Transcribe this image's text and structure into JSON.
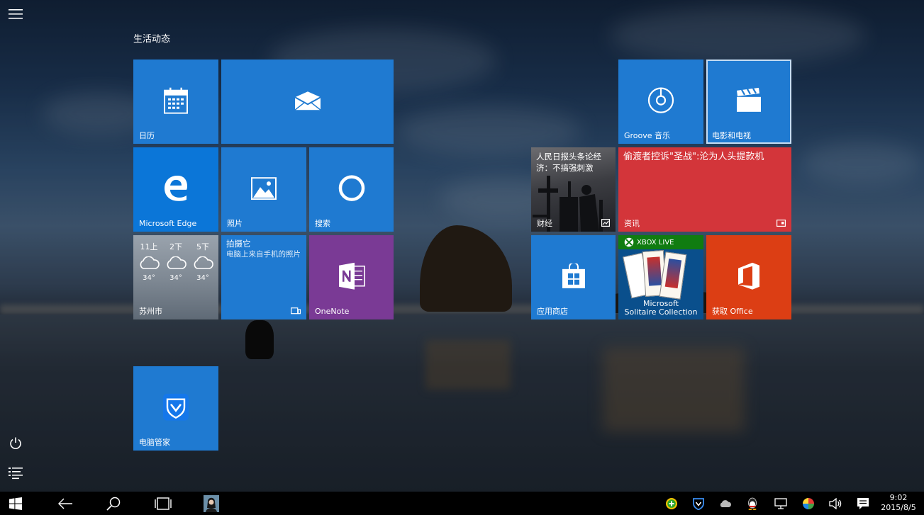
{
  "start": {
    "group_title": "生活动态",
    "tiles": {
      "calendar": {
        "label": "日历"
      },
      "mail": {
        "label": ""
      },
      "edge": {
        "label": "Microsoft Edge"
      },
      "photos": {
        "label": "照片"
      },
      "search": {
        "label": "搜索"
      },
      "weather": {
        "city": "苏州市",
        "forecast": [
          {
            "time": "11上",
            "temp": "34°"
          },
          {
            "time": "2下",
            "temp": "34°"
          },
          {
            "time": "5下",
            "temp": "34°"
          }
        ]
      },
      "camera": {
        "title": "拍摄它",
        "desc": "电脑上来自手机的照片"
      },
      "onenote": {
        "label": "OneNote"
      },
      "groove": {
        "label": "Groove 音乐"
      },
      "movies": {
        "label": "电影和电视"
      },
      "finance": {
        "headline": "人民日报头条论经济：不搞强刺激",
        "label": "财经"
      },
      "news": {
        "headline": "偷渡者控诉\"圣战\":沦为人头提款机",
        "label": "资讯"
      },
      "store": {
        "label": "应用商店"
      },
      "solitaire": {
        "badge": "XBOX LIVE",
        "line1": "Microsoft",
        "line2": "Solitaire Collection"
      },
      "office": {
        "label": "获取 Office"
      },
      "pcmanager": {
        "label": "电脑管家"
      }
    }
  },
  "taskbar": {
    "clock": {
      "time": "9:02",
      "date": "2015/8/5"
    }
  },
  "colors": {
    "tile_blue": "#1f7ad1",
    "edge_blue": "#0b76d8",
    "onenote_purple": "#7a3a95",
    "news_red": "#d3353a",
    "office_orange": "#dc3e14",
    "xbox_green": "#107c10"
  },
  "icons": [
    "hamburger-icon",
    "power-icon",
    "all-apps-icon",
    "windows-logo-icon",
    "back-icon",
    "search-icon",
    "task-view-icon",
    "user-avatar-icon",
    "calendar-icon",
    "mail-icon",
    "edge-icon",
    "photos-icon",
    "cortana-icon",
    "cloud-icon",
    "onenote-icon",
    "groove-icon",
    "clapperboard-icon",
    "store-icon",
    "office-icon",
    "shield-icon",
    "notification-icon",
    "volume-icon",
    "network-icon"
  ]
}
